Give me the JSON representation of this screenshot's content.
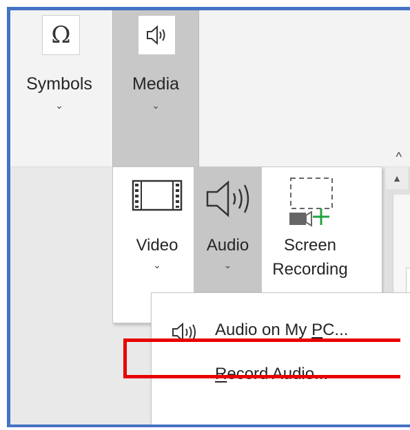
{
  "ribbon": {
    "symbols": {
      "label": "Symbols",
      "chevron": "⌄",
      "icon": "omega-icon"
    },
    "media": {
      "label": "Media",
      "chevron": "⌄",
      "icon": "speaker-icon",
      "state": "pressed"
    },
    "collapse_glyph": "^"
  },
  "media_panel": {
    "video": {
      "label": "Video",
      "chevron": "⌄",
      "icon": "film-icon"
    },
    "audio": {
      "label": "Audio",
      "chevron": "⌄",
      "icon": "speaker-icon",
      "state": "pressed"
    },
    "screen_recording": {
      "label_line1": "Screen",
      "label_line2": "Recording",
      "icon": "screen-record-icon"
    }
  },
  "scroll": {
    "up_glyph": "▲"
  },
  "audio_menu": {
    "items": [
      {
        "pre": "Audio on My ",
        "accel": "P",
        "post": "C...",
        "icon": "speaker-icon"
      },
      {
        "pre": "",
        "accel": "R",
        "post": "ecord Audio...",
        "highlighted": true
      }
    ]
  },
  "colors": {
    "frame_border": "#4472c4",
    "highlight": "#e80000",
    "pressed_bg": "#c6c6c6",
    "plus_green": "#22a33b"
  }
}
